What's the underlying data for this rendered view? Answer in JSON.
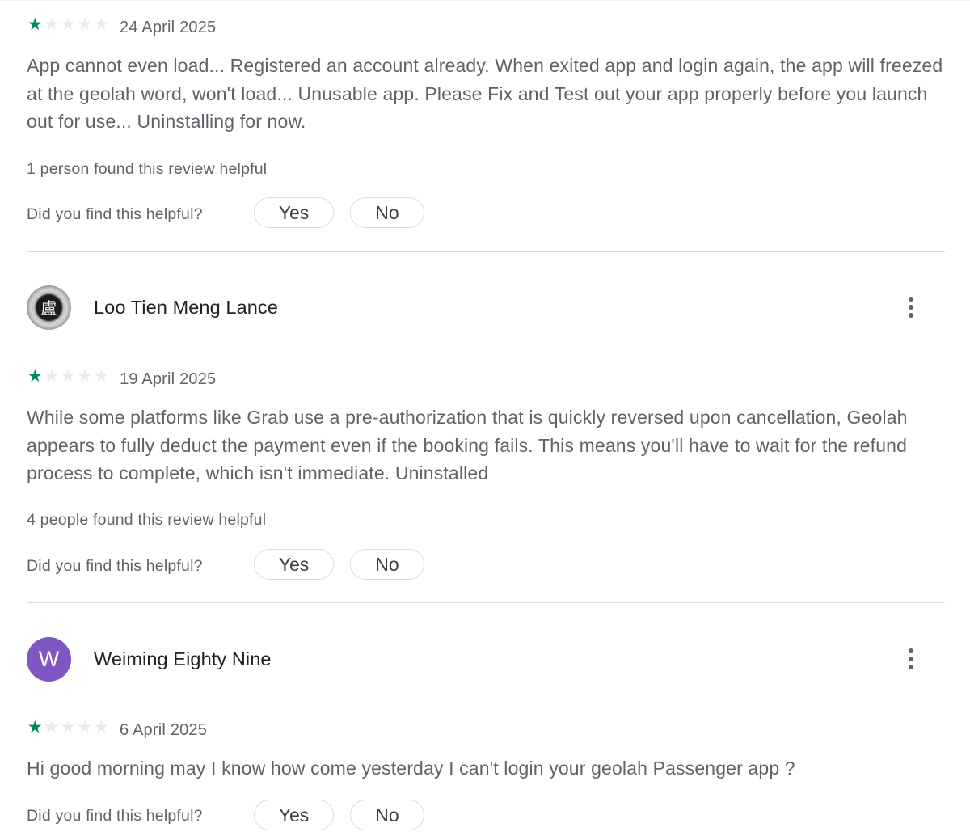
{
  "helpful_prompt": "Did you find this helpful?",
  "yes_label": "Yes",
  "no_label": "No",
  "star_colors": {
    "filled": "#01875f",
    "empty": "#e8eaed"
  },
  "reviews": [
    {
      "rating": 1,
      "max_rating": 5,
      "date": "24 April 2025",
      "text": "App cannot even load... Registered an account already. When exited app and login again, the app will freezed at the geolah word, won't load... Unusable app. Please Fix and Test out your app properly before you launch out for use... Uninstalling for now.",
      "helpful_count_text": "1 person found this review helpful"
    },
    {
      "author": "Loo Tien Meng Lance",
      "avatar_icon": "avatar-image-chinese-character",
      "avatar_glyph": "盧",
      "rating": 1,
      "max_rating": 5,
      "date": "19 April 2025",
      "text": "While some platforms like Grab use a pre-authorization that is quickly reversed upon cancellation, Geolah appears to fully deduct the payment even if the booking fails. This means you'll have to wait for the refund process to complete, which isn't immediate. Uninstalled",
      "helpful_count_text": "4 people found this review helpful"
    },
    {
      "author": "Weiming Eighty Nine",
      "avatar_letter": "W",
      "avatar_color": "#7e57c2",
      "rating": 1,
      "max_rating": 5,
      "date": "6 April 2025",
      "text": "Hi good morning may I know how come yesterday I can't login your geolah Passenger app ?"
    }
  ]
}
